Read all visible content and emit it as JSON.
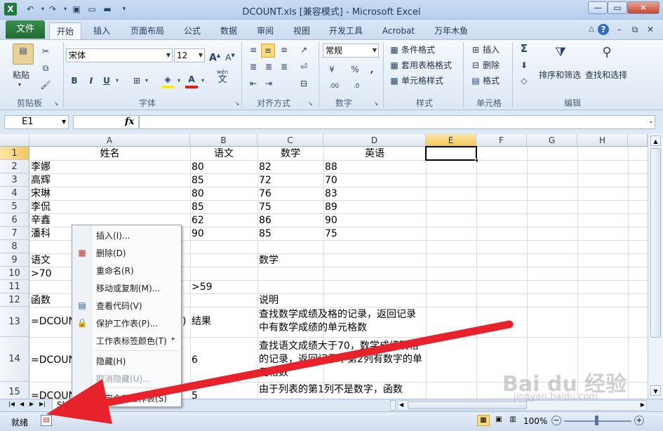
{
  "window": {
    "title": "DCOUNT.xls  [兼容模式] - Microsoft Excel",
    "logo": "X"
  },
  "ribbon_tabs": [
    "文件",
    "开始",
    "插入",
    "页面布局",
    "公式",
    "数据",
    "审阅",
    "视图",
    "开发工具",
    "Acrobat",
    "万年木鱼"
  ],
  "clipboard": {
    "paste": "粘贴",
    "label": "剪贴板"
  },
  "font": {
    "name": "宋体",
    "size": "12",
    "bold": "B",
    "italic": "I",
    "underline": "U",
    "label": "字体",
    "wen": "wén",
    "wen2": "文"
  },
  "align": {
    "label": "对齐方式"
  },
  "number": {
    "format": "常规",
    "label": "数字",
    "percent": "%",
    "comma": ",",
    "inc": ".00",
    "dec": ".0"
  },
  "styles": {
    "conditional": "条件格式",
    "table": "套用表格格式",
    "cell": "单元格样式",
    "label": "样式"
  },
  "cells": {
    "insert": "插入",
    "delete": "删除",
    "format": "格式",
    "label": "单元格"
  },
  "editing": {
    "sum": "Σ",
    "sort": "排序和筛选",
    "find": "查找和选择",
    "label": "编辑"
  },
  "formula_bar": {
    "name_box": "E1",
    "fx": "fx",
    "value": ""
  },
  "columns": [
    "A",
    "B",
    "C",
    "D",
    "E",
    "F",
    "G",
    "H"
  ],
  "rows": [
    "1",
    "2",
    "3",
    "4",
    "5",
    "6",
    "7",
    "8",
    "9",
    "10",
    "11",
    "12",
    "13",
    "14",
    "15"
  ],
  "cells_data": {
    "A1": "姓名",
    "B1": "语文",
    "C1": "数学",
    "D1": "英语",
    "A2": "李娜",
    "B2": "80",
    "C2": "82",
    "D2": "88",
    "A3": "高辉",
    "B3": "85",
    "C3": "72",
    "D3": "70",
    "A4": "宋琳",
    "B4": "80",
    "C4": "76",
    "D4": "83",
    "A5": "李侃",
    "B5": "85",
    "C5": "75",
    "D5": "89",
    "A6": "辛鑫",
    "B6": "62",
    "C6": "86",
    "D6": "90",
    "A7": "潘科",
    "B7": "90",
    "C7": "85",
    "D7": "75",
    "A9": "语文",
    "C9": "数学",
    "A10": ">70",
    "B11": ">59",
    "A12": "函数",
    "C12": "说明",
    "A13": "=DCOUNT",
    "A13b": ")",
    "B13": "结果",
    "C13": "查找数学成绩及格的记录，返回记录中有数学成绩的单元格数",
    "A14": "=DCOUNT",
    "B14": "6",
    "C14": "查找语文成绩大于70，数学成绩及格的记录，返回记录中第2列有数字的单元格数",
    "A15": "=DCOUNT",
    "B15": "5",
    "C15": "由于列表的第1列不是数字，函数"
  },
  "context_menu": [
    {
      "label": "插入(I)...",
      "icon": "insert-icon"
    },
    {
      "label": "删除(D)",
      "icon": "delete-sheet-icon"
    },
    {
      "label": "重命名(R)"
    },
    {
      "label": "移动或复制(M)..."
    },
    {
      "label": "查看代码(V)",
      "icon": "view-code-icon"
    },
    {
      "label": "保护工作表(P)...",
      "icon": "protect-sheet-icon"
    },
    {
      "label": "工作表标签颜色(T)",
      "submenu": "▸"
    },
    {
      "label": "隐藏(H)"
    },
    {
      "label": "取消隐藏(U)...",
      "disabled": true
    },
    {
      "label": "选定全部工作表(S)"
    }
  ],
  "sheet_tab": "Sh",
  "status": {
    "ready": "就绪",
    "zoom": "100%"
  },
  "watermark": {
    "brand": "Bai du 经验",
    "url": "jingyan.baidu.com"
  },
  "annotation": {
    "arrow_color": "#e8222a"
  }
}
